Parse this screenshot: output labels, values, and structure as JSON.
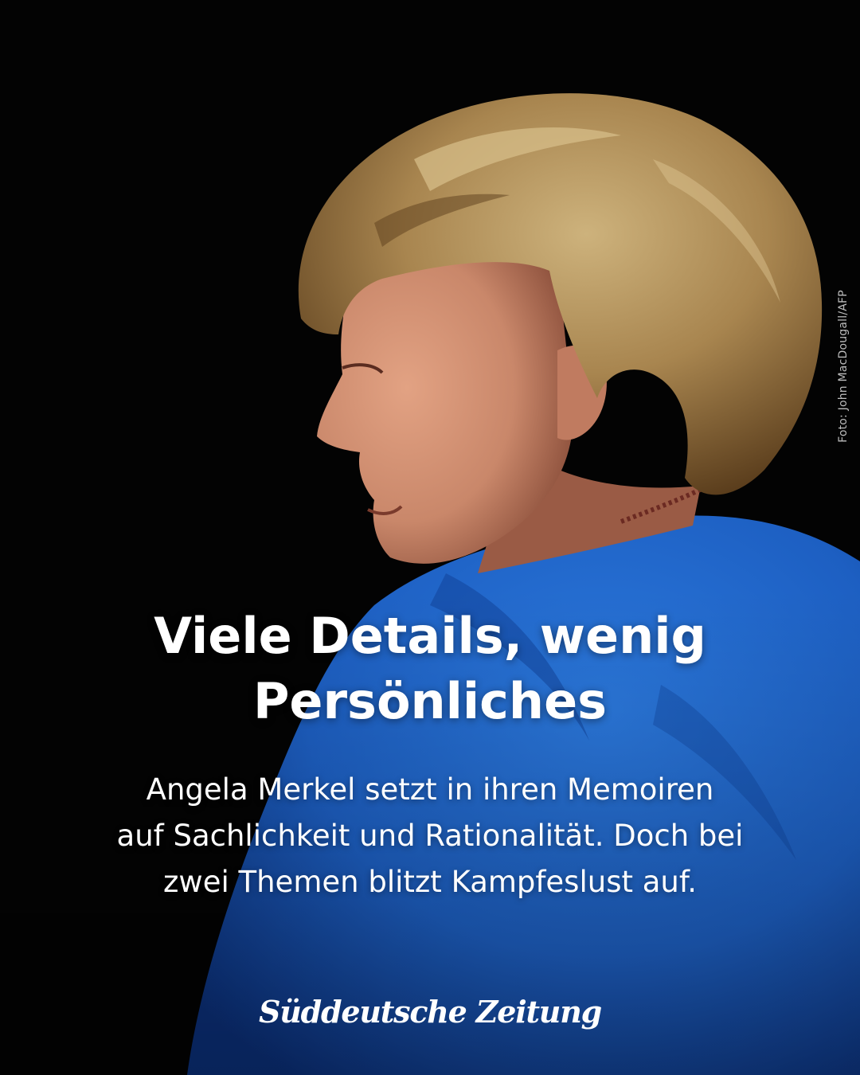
{
  "photo": {
    "credit": "Foto: John MacDougall/AFP",
    "background_color": "#030303",
    "jacket_color": "#1f63c6",
    "hair_color": "#a8854f",
    "skin_color": "#c9876a"
  },
  "headline": {
    "lines": [
      "Viele Details, wenig",
      "Persönliches"
    ]
  },
  "teaser": {
    "lines": [
      "Angela Merkel setzt in ihren Memoiren",
      "auf Sachlichkeit und Rationalität. Doch bei",
      "zwei Themen blitzt Kampfeslust auf."
    ]
  },
  "brand": {
    "logo_text": "Süddeutsche Zeitung",
    "text_color": "#ffffff"
  }
}
